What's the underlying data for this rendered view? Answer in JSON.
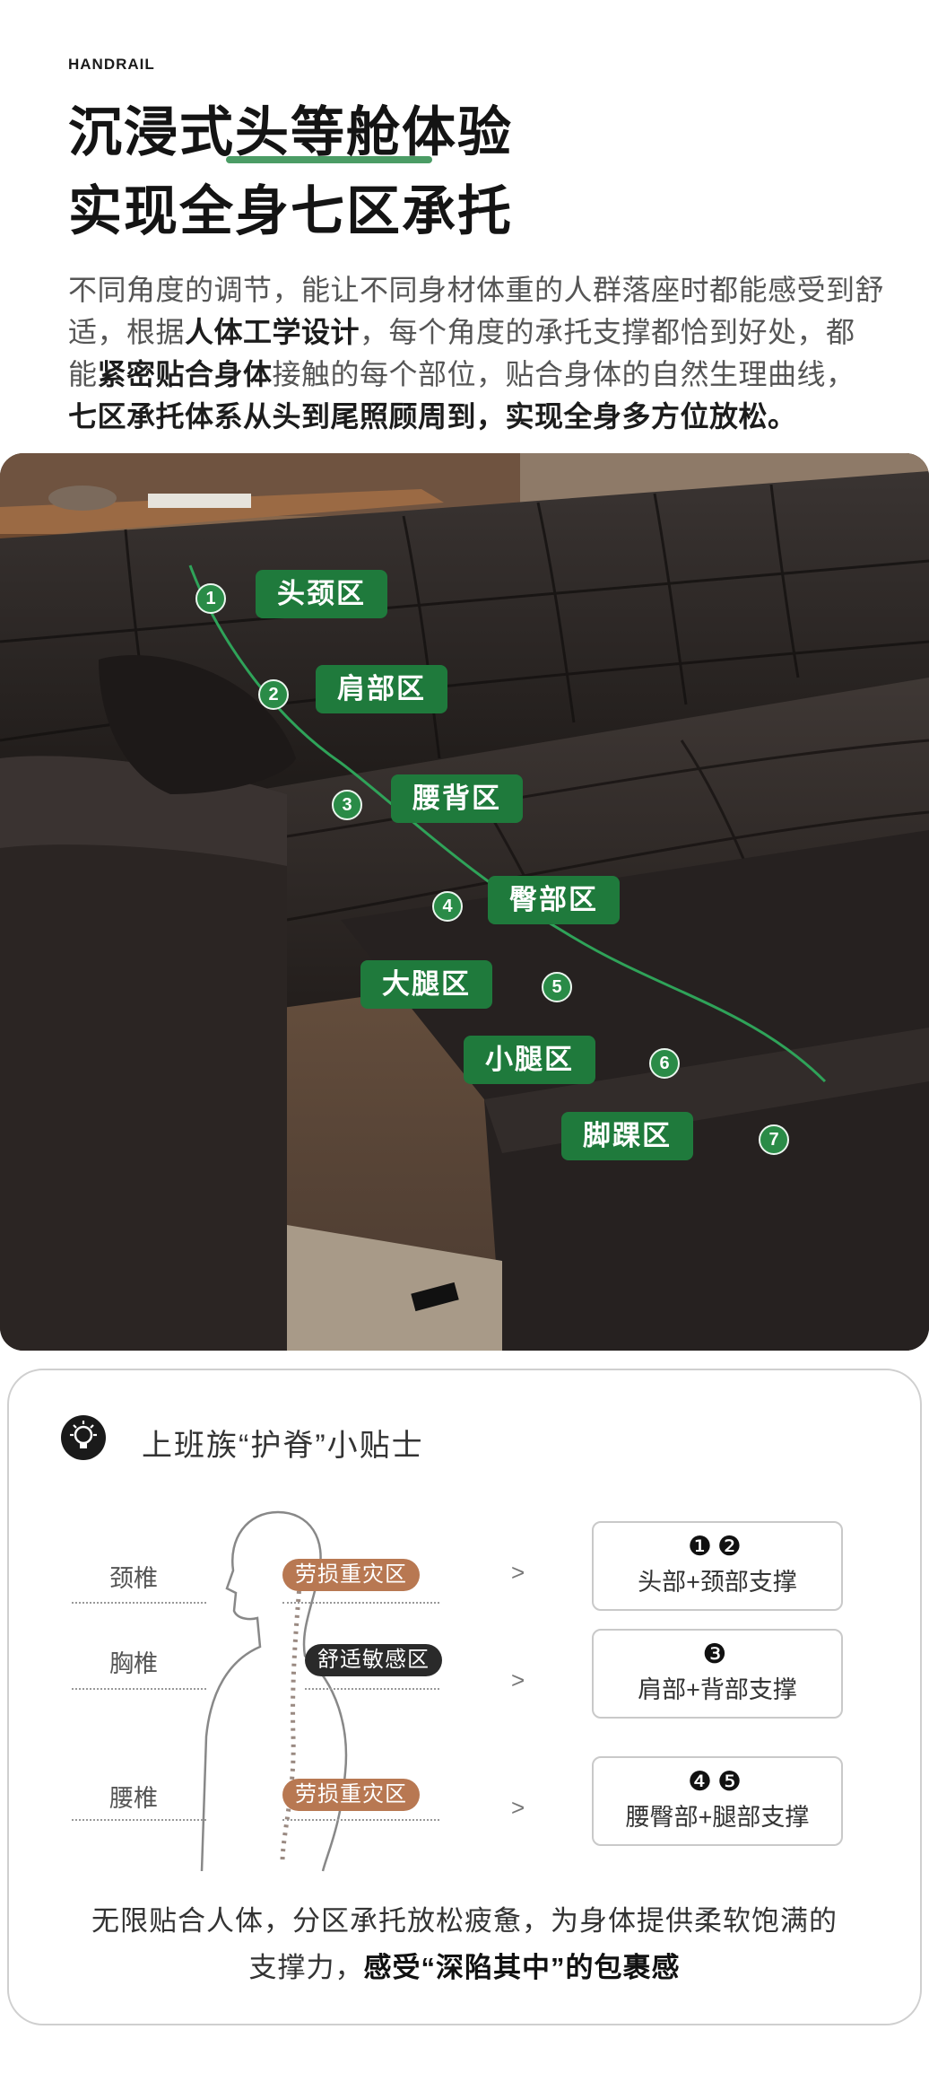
{
  "brand": "HANDRAIL",
  "headline": {
    "line1": "沉浸式头等舱体验",
    "line2": "实现全身七区承托"
  },
  "intro": {
    "p1": "不同角度的调节，能让不同身材体重的人群落座时都能感受到舒适，根据",
    "b1": "人体工学设计",
    "p2": "，每个角度的承托支撑都恰到好处，都能",
    "b2": "紧密贴合身体",
    "p3": "接触的每个部位，贴合身体的自然生理曲线，",
    "b3": "七区承托体系从头到尾照顾周到，实现全身多方位放松。"
  },
  "zones": [
    {
      "num": "1",
      "label": "头颈区"
    },
    {
      "num": "2",
      "label": "肩部区"
    },
    {
      "num": "3",
      "label": "腰背区"
    },
    {
      "num": "4",
      "label": "臀部区"
    },
    {
      "num": "5",
      "label": "大腿区"
    },
    {
      "num": "6",
      "label": "小腿区"
    },
    {
      "num": "7",
      "label": "脚踝区"
    }
  ],
  "tips": {
    "icon": "lightbulb-icon",
    "title": "上班族“护脊”小贴士",
    "rows": [
      {
        "vertebra": "颈椎",
        "risk": "劳损重灾区",
        "arrow": ">",
        "nums": "❶❷",
        "support": "头部+颈部支撑"
      },
      {
        "vertebra": "胸椎",
        "risk": "舒适敏感区",
        "arrow": ">",
        "nums": "❸",
        "support": "肩部+背部支撑"
      },
      {
        "vertebra": "腰椎",
        "risk": "劳损重灾区",
        "arrow": ">",
        "nums": "❹❺",
        "support": "腰臀部+腿部支撑"
      }
    ],
    "closing_line1": "无限贴合人体，分区承托放松疲惫，为身体提供柔软饱满的",
    "closing_prefix": "支撑力，",
    "closing_bold": "感受“深陷其中”的包裹感"
  }
}
